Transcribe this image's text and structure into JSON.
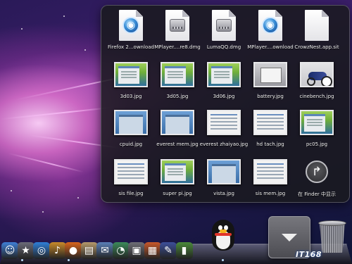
{
  "stack": {
    "items": [
      {
        "label": "Firefox 2...ownload",
        "kind": "doc-quicktime"
      },
      {
        "label": "MPlayer....re8.dmg",
        "kind": "doc-disk"
      },
      {
        "label": "LumaQQ.dmg",
        "kind": "doc-disk"
      },
      {
        "label": "MPlayer....ownload",
        "kind": "doc-quicktime"
      },
      {
        "label": "CrowzNest.app.sit",
        "kind": "doc-blank"
      },
      {
        "label": "3d03.jpg",
        "kind": "shot-win"
      },
      {
        "label": "3d05.jpg",
        "kind": "shot-win"
      },
      {
        "label": "3d06.jpg",
        "kind": "shot-win"
      },
      {
        "label": "battery.jpg",
        "kind": "shot-gray"
      },
      {
        "label": "cinebench.jpg",
        "kind": "shot-bike"
      },
      {
        "label": "cpuid.jpg",
        "kind": "shot-blue"
      },
      {
        "label": "everest mem.jpg",
        "kind": "shot-blue"
      },
      {
        "label": "everest zhaiyao.jpg",
        "kind": "shot-white"
      },
      {
        "label": "hd tach.jpg",
        "kind": "shot-white"
      },
      {
        "label": "pc05.jpg",
        "kind": "shot-win"
      },
      {
        "label": "sis file.jpg",
        "kind": "shot-white"
      },
      {
        "label": "super pi.jpg",
        "kind": "shot-win"
      },
      {
        "label": "vista.jpg",
        "kind": "shot-blue"
      },
      {
        "label": "sis mem.jpg",
        "kind": "shot-white"
      }
    ],
    "finder_label": "在 Finder 中显示"
  },
  "dock": {
    "items": [
      {
        "name": "finder-dock-icon",
        "glyph": "☺",
        "color": "#3f7fd6"
      },
      {
        "name": "imovie-dock-icon",
        "glyph": "★",
        "color": "#6a6a78"
      },
      {
        "name": "safari-dock-icon",
        "glyph": "◎",
        "color": "#2f7fd8"
      },
      {
        "name": "garageband-dock-icon",
        "glyph": "♪",
        "color": "#c88a2a"
      },
      {
        "name": "firefox-dock-icon",
        "glyph": "●",
        "color": "#d8641c"
      },
      {
        "name": "preview-dock-icon",
        "glyph": "▤",
        "color": "#b59a6a"
      },
      {
        "name": "mail-dock-icon",
        "glyph": "✉",
        "color": "#5a7fb8"
      },
      {
        "name": "timemachine-dock-icon",
        "glyph": "◔",
        "color": "#3c8a5a"
      },
      {
        "name": "photobooth-dock-icon",
        "glyph": "▣",
        "color": "#6e6e76"
      },
      {
        "name": "app-dock-icon",
        "glyph": "▦",
        "color": "#c8582a"
      },
      {
        "name": "xcode-dock-icon",
        "glyph": "✎",
        "color": "#3d4f9a"
      },
      {
        "name": "activity-monitor-dock-icon",
        "glyph": "▮",
        "color": "#4a8a3a"
      }
    ]
  },
  "watermark": "ІТ168"
}
